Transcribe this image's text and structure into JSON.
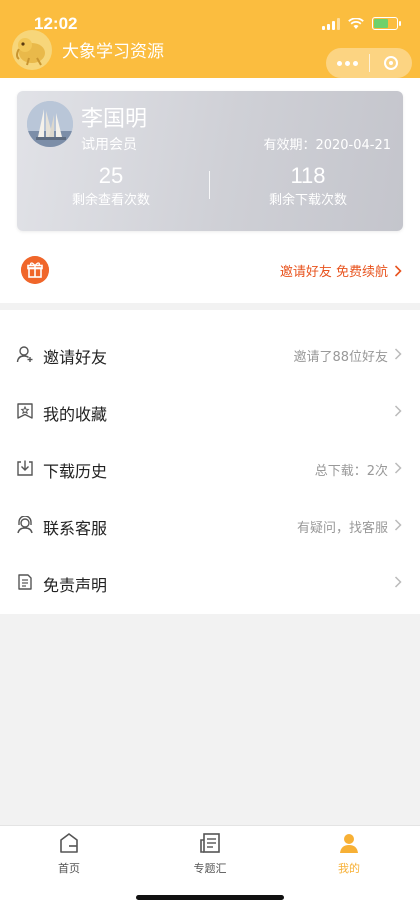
{
  "status_bar": {
    "time": "12:02"
  },
  "app": {
    "title": "大象学习资源"
  },
  "profile": {
    "name": "李国明",
    "level": "试用会员",
    "validity": "有效期：2020-04-21",
    "views_remaining": {
      "value": "25",
      "label": "剩余查看次数"
    },
    "downloads_remaining": {
      "value": "118",
      "label": "剩余下载次数"
    }
  },
  "invite_banner": {
    "text": "邀请好友 免费续航"
  },
  "menu": {
    "items": [
      {
        "label": "邀请好友",
        "value": "邀请了88位好友",
        "icon": "user-add-icon"
      },
      {
        "label": "我的收藏",
        "value": "",
        "icon": "favorite-icon"
      },
      {
        "label": "下载历史",
        "value": "总下载：2次",
        "icon": "download-icon"
      },
      {
        "label": "联系客服",
        "value": "有疑问，找客服",
        "icon": "headset-icon"
      },
      {
        "label": "免责声明",
        "value": "",
        "icon": "document-icon"
      }
    ]
  },
  "tabbar": {
    "tabs": [
      {
        "label": "首页",
        "icon": "home-icon",
        "active": false
      },
      {
        "label": "专题汇",
        "icon": "topics-icon",
        "active": false
      },
      {
        "label": "我的",
        "icon": "profile-icon",
        "active": true
      }
    ]
  },
  "colors": {
    "brand": "#fbbd3f",
    "accent": "#e8541f",
    "active_tab": "#f7b035"
  }
}
